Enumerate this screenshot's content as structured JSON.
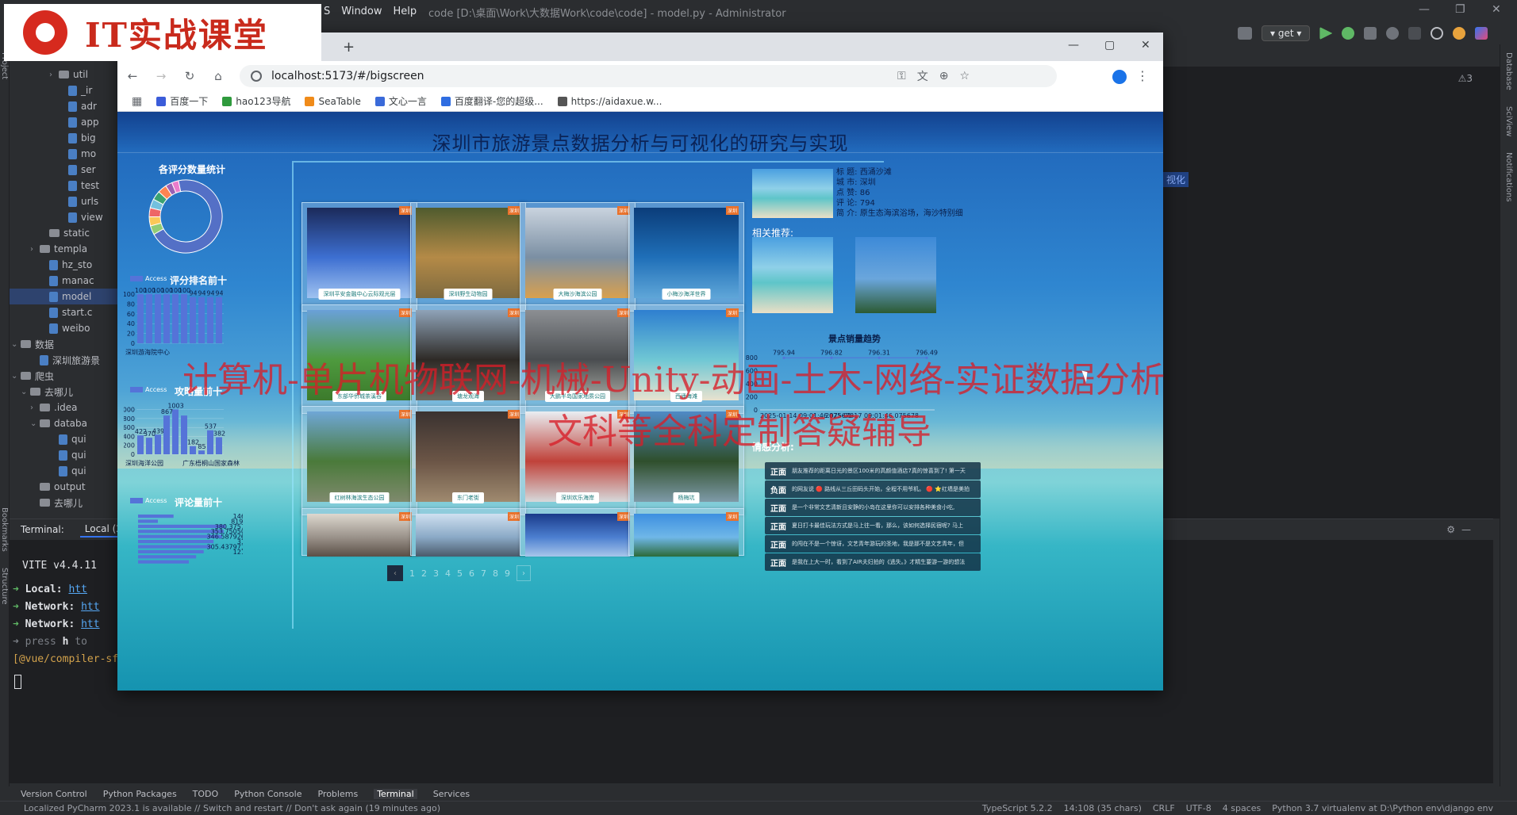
{
  "ide": {
    "menus": [
      "S",
      "Window",
      "Help"
    ],
    "window_title": "code [D:\\桌面\\Work\\大数据Work\\code\\code] - model.py - Administrator",
    "run_config": "get",
    "editor_snippet": "视化",
    "warning_count": "⚠3",
    "right_stripe": [
      "Database",
      "SciView",
      "Notifications"
    ],
    "left_stripe": [
      "Project",
      "Bookmarks",
      "Structure"
    ],
    "tree": [
      {
        "indent": 5,
        "type": "folder",
        "label": "util",
        "caret": "›"
      },
      {
        "indent": 6,
        "type": "file",
        "label": "_ir"
      },
      {
        "indent": 6,
        "type": "file",
        "label": "adr"
      },
      {
        "indent": 6,
        "type": "file",
        "label": "app"
      },
      {
        "indent": 6,
        "type": "file",
        "label": "big"
      },
      {
        "indent": 6,
        "type": "file",
        "label": "mo"
      },
      {
        "indent": 6,
        "type": "file",
        "label": "ser"
      },
      {
        "indent": 6,
        "type": "file",
        "label": "test"
      },
      {
        "indent": 6,
        "type": "file",
        "label": "urls"
      },
      {
        "indent": 6,
        "type": "file",
        "label": "view"
      },
      {
        "indent": 4,
        "type": "folder",
        "label": "static"
      },
      {
        "indent": 3,
        "type": "folder",
        "label": "templa",
        "caret": "›"
      },
      {
        "indent": 4,
        "type": "file",
        "label": "hz_sto"
      },
      {
        "indent": 4,
        "type": "file",
        "label": "manac"
      },
      {
        "indent": 4,
        "type": "file",
        "label": "model",
        "selected": true
      },
      {
        "indent": 4,
        "type": "file",
        "label": "start.c"
      },
      {
        "indent": 4,
        "type": "file",
        "label": "weibo"
      },
      {
        "indent": 1,
        "type": "folder",
        "label": "数据",
        "caret": "⌄"
      },
      {
        "indent": 3,
        "type": "file",
        "label": "深圳旅游景"
      },
      {
        "indent": 1,
        "type": "folder",
        "label": "爬虫",
        "caret": "⌄"
      },
      {
        "indent": 2,
        "type": "folder",
        "label": "去哪儿",
        "caret": "⌄"
      },
      {
        "indent": 3,
        "type": "folder",
        "label": ".idea",
        "caret": "›"
      },
      {
        "indent": 3,
        "type": "folder",
        "label": "databa",
        "caret": "⌄"
      },
      {
        "indent": 5,
        "type": "file",
        "label": "qui"
      },
      {
        "indent": 5,
        "type": "file",
        "label": "qui"
      },
      {
        "indent": 5,
        "type": "file",
        "label": "qui"
      },
      {
        "indent": 3,
        "type": "folder",
        "label": "output"
      },
      {
        "indent": 3,
        "type": "folder",
        "label": "去哪儿"
      }
    ],
    "terminal": {
      "tabs": [
        "Terminal:",
        "Local (2)"
      ],
      "vite": "VITE v4.4.11",
      "local_label": "Local:",
      "local_url": "htt",
      "network_label": "Network:",
      "network_url": "htt",
      "network_label2": "Network:",
      "network_url2": "htt",
      "press": "press",
      "press_key": "h",
      "press_rest": "to",
      "warn": "[@vue/compiler-sf"
    },
    "bottom_tabs": [
      "Version Control",
      "Python Packages",
      "TODO",
      "Python Console",
      "Problems",
      "Terminal",
      "Services"
    ],
    "status_left": "Localized PyCharm 2023.1 is available // Switch and restart // Don't ask again (19 minutes ago)",
    "status_right": [
      "TypeScript 5.2.2",
      "14:108 (35 chars)",
      "CRLF",
      "UTF-8",
      "4 spaces",
      "Python 3.7 virtualenv at D:\\Python env\\django env"
    ]
  },
  "browser": {
    "url": "localhost:5173/#/bigscreen",
    "bookmarks": [
      {
        "label": "百度一下",
        "color": "#3b5cd9"
      },
      {
        "label": "hao123导航",
        "color": "#2f9a3d"
      },
      {
        "label": "SeaTable",
        "color": "#f08b1a"
      },
      {
        "label": "文心一言",
        "color": "#3a6ad9"
      },
      {
        "label": "百度翻译-您的超级...",
        "color": "#2f6de1"
      },
      {
        "label": "https://aidaxue.w...",
        "color": "#555555"
      }
    ]
  },
  "dashboard": {
    "title": "深圳市旅游景点数据分析与可视化的研究与实现",
    "left": {
      "donut_title": "各评分数量统计",
      "rating_title": "评分排名前十",
      "legend_access": "Access",
      "rating_xlabel": "深圳游海院中心",
      "guide_title": "攻略量前十",
      "guide_xlabels": [
        "深圳海洋公园",
        "广东梧桐山国家森林"
      ],
      "comment_title": "评论量前十"
    },
    "cards": [
      {
        "name": "深圳平安金融中心云际观光层",
        "badge": "深圳",
        "colors": [
          "#1b2a5a",
          "#3d6fd1",
          "#9fc2f0"
        ]
      },
      {
        "name": "深圳野生动物园",
        "badge": "深圳",
        "colors": [
          "#4f5b2e",
          "#b48a47",
          "#7e6a3f"
        ]
      },
      {
        "name": "大梅沙海滨公园",
        "badge": "深圳",
        "colors": [
          "#c9d3de",
          "#7b8fa3",
          "#d9a04e"
        ]
      },
      {
        "name": "小梅沙海洋世界",
        "badge": "深圳",
        "colors": [
          "#0b3d7a",
          "#1f6fb8",
          "#5fa6d8"
        ]
      },
      {
        "name": "东部华侨城茶溪谷",
        "badge": "深圳",
        "colors": [
          "#6aa0d8",
          "#4e9a3e",
          "#3c7a2c"
        ]
      },
      {
        "name": "塘龙观海",
        "badge": "深圳",
        "colors": [
          "#8fa3b8",
          "#2e2a26",
          "#6d6a60"
        ]
      },
      {
        "name": "大鹏半岛国家地质公园",
        "badge": "深圳",
        "colors": [
          "#8c8f93",
          "#4a4d50",
          "#a9aaa3"
        ]
      },
      {
        "name": "西涌海滩",
        "badge": "深圳",
        "colors": [
          "#2e7fd0",
          "#6fc7d4",
          "#e8e2cf"
        ]
      },
      {
        "name": "红树林海滨生态公园",
        "badge": "深圳",
        "colors": [
          "#6fa7d6",
          "#4a7a3a",
          "#7f8a6d"
        ]
      },
      {
        "name": "东门老街",
        "badge": "深圳",
        "colors": [
          "#3a3230",
          "#6b5546",
          "#9f8a6f"
        ]
      },
      {
        "name": "深圳欢乐海岸",
        "badge": "深圳",
        "colors": [
          "#e9eef2",
          "#c0423a",
          "#d6d9db"
        ]
      },
      {
        "name": "杨梅坑",
        "badge": "深圳",
        "colors": [
          "#4f8ac6",
          "#2f4f2c",
          "#7e9aa8"
        ]
      },
      {
        "name": "",
        "badge": "深圳",
        "colors": [
          "#ddd8cf",
          "#9a928a",
          "#5a4f46"
        ]
      },
      {
        "name": "",
        "badge": "深圳",
        "colors": [
          "#cfe0f0",
          "#8aa9c6",
          "#4a5a6a"
        ]
      },
      {
        "name": "",
        "badge": "深圳",
        "colors": [
          "#1a3b8a",
          "#4c7fd0",
          "#a7c6ea"
        ]
      },
      {
        "name": "",
        "badge": "深圳",
        "colors": [
          "#3d8fe0",
          "#6fb7e8",
          "#2c6a3a"
        ]
      }
    ],
    "pager": {
      "prev": "‹",
      "pages": [
        "1",
        "2",
        "3",
        "4",
        "5",
        "6",
        "7",
        "8",
        "9"
      ],
      "next": "›",
      "current": "1"
    },
    "detail": {
      "title": "标 题: 西涌沙滩",
      "city": "城 市: 深圳",
      "likes": "点 赞: 86",
      "comments": "评 论: 794",
      "intro": "简 介: 原生态海滨浴场，海沙特别细"
    },
    "recommend_title": "相关推荐:",
    "trend_title": "景点销量趋势",
    "sentiment_title": "情感分析:",
    "sentiments": [
      {
        "polarity": "正面",
        "text": "朋友推荐的距离日光的景区100米的高颜值酒店7真的惊喜到了! 第一天"
      },
      {
        "polarity": "负面",
        "text": "的网友说 🔴 路线从三丘田码头开始，全程不用爷机。 🔴 ⭐红墙是美拍"
      },
      {
        "polarity": "正面",
        "text": "是一个非常文艺清新且安静的小岛在这里你可以安排各种美食小吃,"
      },
      {
        "polarity": "正面",
        "text": "夏日打卡最佳玩法方式是马上往一看，那么，该如何选择民宿呢? 马上"
      },
      {
        "polarity": "正面",
        "text": "的闯在不是一个惊讶，文艺青年游玩的圣地，我是那不是文艺青年，但"
      },
      {
        "polarity": "正面",
        "text": "是我在上大一时，看到了AIR夫妇拍的《逃失。》才精生要游一游的想法"
      }
    ]
  },
  "chart_data": [
    {
      "type": "pie",
      "title": "各评分数量统计",
      "note": "donut chart; dominant slice plus several small slices",
      "values": [
        70,
        4,
        4,
        4,
        4,
        4,
        4,
        3,
        3
      ],
      "colors": [
        "#5470c6",
        "#91cc75",
        "#fac858",
        "#ee6666",
        "#73c0de",
        "#3ba272",
        "#fc8452",
        "#9a60b4",
        "#ea7ccc"
      ]
    },
    {
      "type": "bar",
      "title": "评分排名前十",
      "series": [
        {
          "name": "Access",
          "values": [
            100,
            100,
            100,
            100,
            100,
            100,
            94,
            94,
            94,
            94
          ]
        }
      ],
      "value_labels": [
        "100",
        "100",
        "100",
        "100",
        "100",
        "100",
        "94",
        "94",
        "94",
        "94"
      ],
      "yticks": [
        0,
        20,
        40,
        60,
        80,
        100
      ],
      "ylim": [
        0,
        100
      ],
      "xlabel_first": "深圳游海院中心"
    },
    {
      "type": "bar",
      "title": "攻略量前十",
      "series": [
        {
          "name": "Access",
          "values": [
            422,
            370,
            439,
            867,
            1003,
            867,
            182,
            85,
            537,
            382
          ]
        }
      ],
      "value_labels": [
        "422",
        "370",
        "439",
        "867",
        "1003",
        "",
        "182",
        "85",
        "537",
        "382"
      ],
      "yticks": [
        0,
        200,
        400,
        600,
        800,
        1000
      ],
      "ylim": [
        0,
        1100
      ]
    },
    {
      "type": "bar",
      "orientation": "horizontal",
      "title": "评论量前十",
      "series": [
        {
          "name": "Access",
          "values": [
            1466,
            819.6,
            3607.4,
            3535.7,
            3467.9,
            3120,
            3054,
            2712,
            2400,
            2100
          ]
        }
      ],
      "value_labels": [
        "1466",
        "819.6",
        "380.37574",
        "353.750503",
        "346.5879268",
        "312",
        "305.4379712",
        "1211"
      ]
    },
    {
      "type": "line",
      "title": "景点销量趋势",
      "x": [
        "2025-01-14 09:01:46.075678",
        "2025-01-17 09:01:46.075678"
      ],
      "series": [
        {
          "name": "",
          "values": [
            795.94,
            796.82,
            796.31,
            796.49
          ]
        }
      ],
      "value_labels": [
        "795.94",
        "796.82",
        "796.31",
        "796.49"
      ],
      "yticks": [
        0,
        200,
        400,
        600,
        800
      ],
      "ylim": [
        0,
        800
      ]
    }
  ],
  "overlays": {
    "logo_text": "IT实战课堂",
    "watermark_line1": "计算机-单片机物联网-机械-Unity-动画-土木-网络-实证数据分析",
    "watermark_line2": "文科等全科定制答疑辅导"
  }
}
